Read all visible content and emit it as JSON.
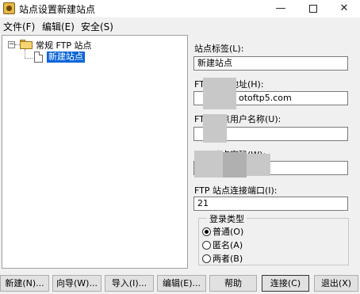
{
  "window": {
    "title": "站点设置新建站点",
    "minimize": "—",
    "close": "✕"
  },
  "menu": {
    "file": "文件(F)",
    "edit": "编辑(E)",
    "security": "安全(S)"
  },
  "tree": {
    "expander": "−",
    "group": "常规 FTP 站点",
    "site": "新建站点"
  },
  "form": {
    "site_label": {
      "label": "站点标签(L):",
      "value": "新建站点"
    },
    "host": {
      "label": "FTP 主机地址(H):",
      "value": "otoftp5.com"
    },
    "user": {
      "label": "FTP 站点用户名称(U):",
      "value": ""
    },
    "password": {
      "label": "FTP 站点密码(W):",
      "value": ""
    },
    "port": {
      "label": "FTP 站点连接端口(I):",
      "value": "21"
    },
    "login_type": {
      "title": "登录类型",
      "options": [
        "普通(O)",
        "匿名(A)",
        "两者(B)"
      ],
      "selected": 0
    }
  },
  "buttons": {
    "new": "新建(N)...",
    "wizard": "向导(W)...",
    "import": "导入(I)...",
    "edit": "编辑(E)...",
    "help": "帮助",
    "connect": "连接(C)",
    "exit": "退出(X)"
  }
}
